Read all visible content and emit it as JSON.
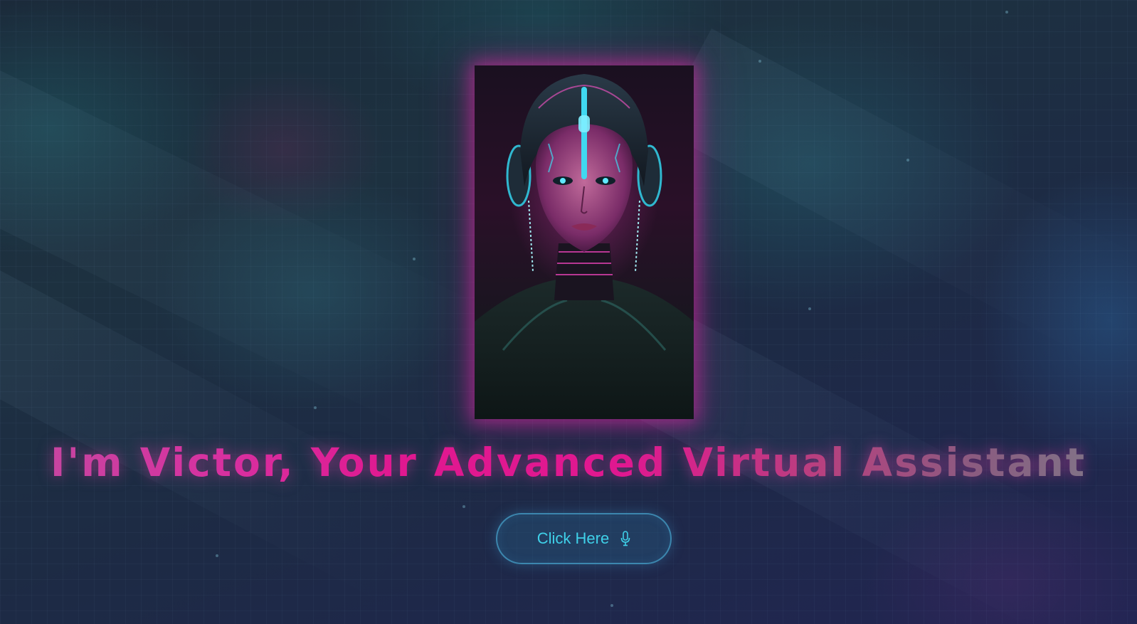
{
  "hero": {
    "heading": "I'm Victor, Your Advanced Virtual Assistant",
    "portrait_icon": "ai-assistant-portrait"
  },
  "cta": {
    "label": "Click Here",
    "icon": "microphone-icon"
  },
  "colors": {
    "accent_pink": "#e01890",
    "accent_cyan": "#3fd0e8",
    "background": "#1d2a45"
  }
}
